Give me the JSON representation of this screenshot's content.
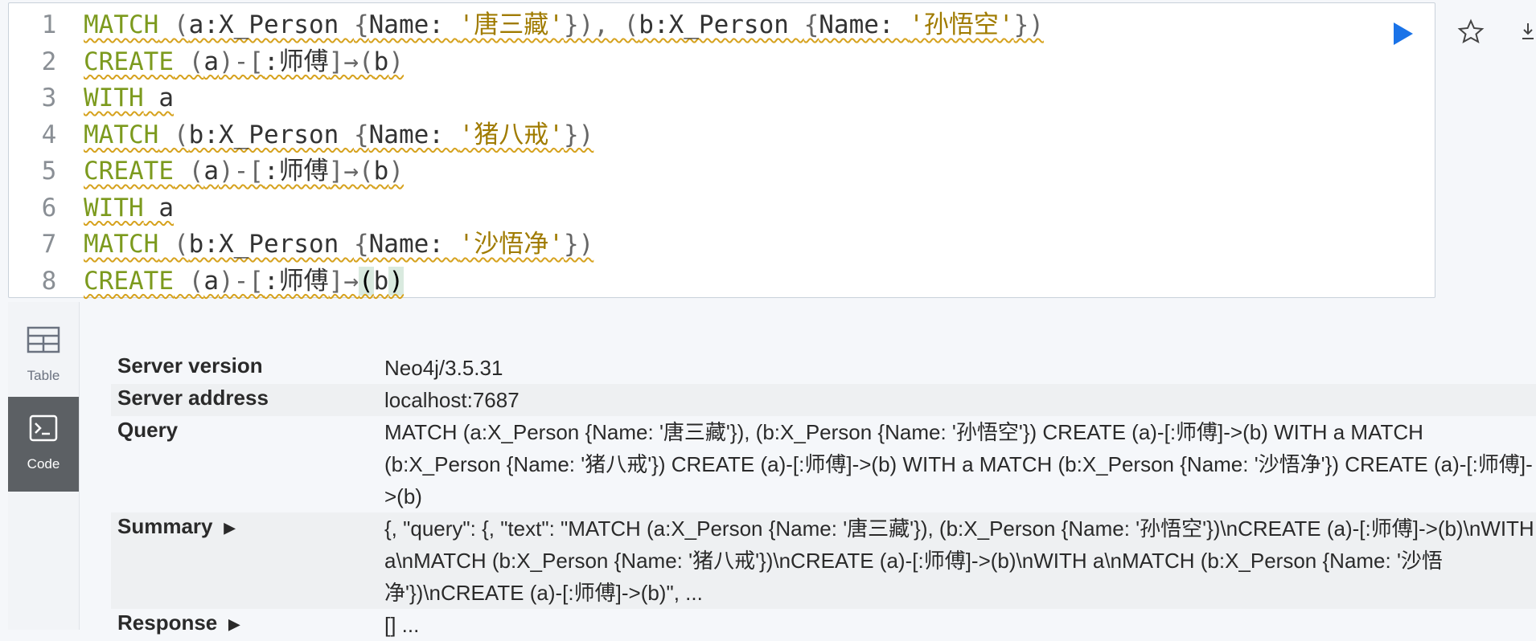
{
  "editor": {
    "lines": [
      {
        "n": "1",
        "tokens": [
          [
            "k",
            "MATCH"
          ],
          [
            "p",
            " ("
          ],
          [
            "id",
            "a:X_Person "
          ],
          [
            "p",
            "{"
          ],
          [
            "id",
            "Name: "
          ],
          [
            "s",
            "'唐三藏'"
          ],
          [
            "p",
            "}), ("
          ],
          [
            "id",
            "b:X_Person "
          ],
          [
            "p",
            "{"
          ],
          [
            "id",
            "Name: "
          ],
          [
            "s",
            "'孙悟空'"
          ],
          [
            "p",
            "})"
          ]
        ]
      },
      {
        "n": "2",
        "tokens": [
          [
            "k",
            "CREATE"
          ],
          [
            "p",
            " ("
          ],
          [
            "id",
            "a"
          ],
          [
            "p",
            ")-["
          ],
          [
            "id",
            ":师傅"
          ],
          [
            "p",
            "]→("
          ],
          [
            "id",
            "b"
          ],
          [
            "p",
            ")"
          ]
        ]
      },
      {
        "n": "3",
        "tokens": [
          [
            "k",
            "WITH"
          ],
          [
            "id",
            " a"
          ]
        ]
      },
      {
        "n": "4",
        "tokens": [
          [
            "k",
            "MATCH"
          ],
          [
            "p",
            " ("
          ],
          [
            "id",
            "b:X_Person "
          ],
          [
            "p",
            "{"
          ],
          [
            "id",
            "Name: "
          ],
          [
            "s",
            "'猪八戒'"
          ],
          [
            "p",
            "})"
          ]
        ]
      },
      {
        "n": "5",
        "tokens": [
          [
            "k",
            "CREATE"
          ],
          [
            "p",
            " ("
          ],
          [
            "id",
            "a"
          ],
          [
            "p",
            ")-["
          ],
          [
            "id",
            ":师傅"
          ],
          [
            "p",
            "]→("
          ],
          [
            "id",
            "b"
          ],
          [
            "p",
            ")"
          ]
        ]
      },
      {
        "n": "6",
        "tokens": [
          [
            "k",
            "WITH"
          ],
          [
            "id",
            " a"
          ]
        ]
      },
      {
        "n": "7",
        "tokens": [
          [
            "k",
            "MATCH"
          ],
          [
            "p",
            " ("
          ],
          [
            "id",
            "b:X_Person "
          ],
          [
            "p",
            "{"
          ],
          [
            "id",
            "Name: "
          ],
          [
            "s",
            "'沙悟净'"
          ],
          [
            "p",
            "})"
          ]
        ]
      },
      {
        "n": "8",
        "tokens": [
          [
            "k",
            "CREATE"
          ],
          [
            "p",
            " ("
          ],
          [
            "id",
            "a"
          ],
          [
            "p",
            ")-["
          ],
          [
            "id",
            ":师傅"
          ],
          [
            "p",
            "]→"
          ],
          [
            "hl",
            "("
          ],
          [
            "id",
            "b"
          ],
          [
            "hl",
            ")"
          ]
        ]
      }
    ]
  },
  "toolbar": {
    "run_icon": "play-icon",
    "favorite_icon": "star-icon",
    "more_icon": "download-icon",
    "accent": "#1a73e8"
  },
  "sidebar": {
    "table_label": "Table",
    "code_label": "Code"
  },
  "results": {
    "server_version": {
      "key": "Server version",
      "value": "Neo4j/3.5.31"
    },
    "server_address": {
      "key": "Server address",
      "value": "localhost:7687"
    },
    "query": {
      "key": "Query",
      "value": "MATCH (a:X_Person {Name: '唐三藏'}), (b:X_Person {Name: '孙悟空'}) CREATE (a)-[:师傅]->(b) WITH a MATCH (b:X_Person {Name: '猪八戒'}) CREATE (a)-[:师傅]->(b) WITH a MATCH (b:X_Person {Name: '沙悟净'}) CREATE (a)-[:师傅]->(b)"
    },
    "summary": {
      "key": "Summary",
      "value": "{, \"query\": {, \"text\": \"MATCH (a:X_Person {Name: '唐三藏'}), (b:X_Person {Name: '孙悟空'})\\nCREATE (a)-[:师傅]->(b)\\nWITH a\\nMATCH (b:X_Person {Name: '猪八戒'})\\nCREATE (a)-[:师傅]->(b)\\nWITH a\\nMATCH (b:X_Person {Name: '沙悟净'})\\nCREATE (a)-[:师傅]->(b)\", ..."
    },
    "response": {
      "key": "Response",
      "value": "[] ..."
    }
  }
}
